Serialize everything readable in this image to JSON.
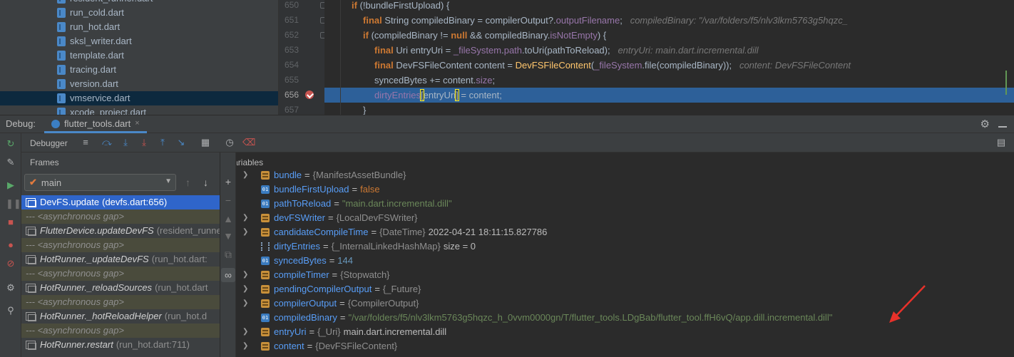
{
  "project_files": [
    {
      "name": "resident_runner.dart",
      "selected": false
    },
    {
      "name": "run_cold.dart",
      "selected": false
    },
    {
      "name": "run_hot.dart",
      "selected": false
    },
    {
      "name": "sksl_writer.dart",
      "selected": false
    },
    {
      "name": "template.dart",
      "selected": false
    },
    {
      "name": "tracing.dart",
      "selected": false
    },
    {
      "name": "version.dart",
      "selected": false
    },
    {
      "name": "vmservice.dart",
      "selected": true
    },
    {
      "name": "xcode_project.dart",
      "selected": false
    }
  ],
  "editor": {
    "line_numbers": [
      "650",
      "651",
      "652",
      "653",
      "654",
      "655",
      "656",
      "657"
    ],
    "current_line": "656",
    "code": {
      "l650": {
        "kw": "if",
        "text": " (!bundleFirstUpload) {"
      },
      "l651": {
        "kw": "final",
        "type": " String compiledBinary = compilerOutput?.",
        "field": "outputFilename",
        "tail": ";",
        "hint": "compiledBinary: \"/var/folders/f5/nlv3lkm5763g5hqzc_"
      },
      "l652": {
        "kw": "if",
        "a": " (compiledBinary != ",
        "kw2": "null",
        "b": " && compiledBinary.",
        "field": "isNotEmpty",
        "tail": ") {"
      },
      "l653": {
        "kw": "final",
        "a": " Uri entryUri = ",
        "field": "_fileSystem",
        "b": ".",
        "field2": "path",
        "c": ".toUri(pathToReload);",
        "hint": "entryUri: main.dart.incremental.dill"
      },
      "l654": {
        "kw": "final",
        "a": " DevFSFileContent content = ",
        "fn": "DevFSFileContent",
        "b": "(",
        "field": "_fileSystem",
        "c": ".file(compiledBinary));",
        "hint": "content: DevFSFileContent"
      },
      "l655": {
        "a": "syncedBytes += content.",
        "field": "size",
        "tail": ";"
      },
      "l656": {
        "field": "dirtyEntries",
        "b1": "[",
        "a": "entryUri",
        "b2": "]",
        "tail": " = content;"
      },
      "l657": {
        "text": "}"
      }
    }
  },
  "debug_bar": {
    "label": "Debug:",
    "tab": "flutter_tools.dart",
    "close": "×"
  },
  "toolbar": {
    "debugger_label": "Debugger"
  },
  "frames": {
    "header": "Frames",
    "thread": "main",
    "items": [
      {
        "name": "DevFS.update",
        "loc": "(devfs.dart:656)",
        "kind": "selected"
      },
      {
        "name": "--- <asynchronous gap>",
        "loc": "",
        "kind": "gap"
      },
      {
        "name": "FlutterDevice.updateDevFS",
        "loc": "(resident_runner.dart",
        "kind": "frame"
      },
      {
        "name": "--- <asynchronous gap>",
        "loc": "",
        "kind": "gap"
      },
      {
        "name": "HotRunner._updateDevFS",
        "loc": "(run_hot.dart:",
        "kind": "frame"
      },
      {
        "name": "--- <asynchronous gap>",
        "loc": "",
        "kind": "gap"
      },
      {
        "name": "HotRunner._reloadSources",
        "loc": "(run_hot.dart",
        "kind": "frame"
      },
      {
        "name": "--- <asynchronous gap>",
        "loc": "",
        "kind": "gap"
      },
      {
        "name": "HotRunner._hotReloadHelper",
        "loc": "(run_hot.d",
        "kind": "frame"
      },
      {
        "name": "--- <asynchronous gap>",
        "loc": "",
        "kind": "gap"
      },
      {
        "name": "HotRunner.restart",
        "loc": "(run_hot.dart:711)",
        "kind": "frame"
      }
    ]
  },
  "variables": {
    "header": "Variables",
    "items": [
      {
        "name": "bundle",
        "type": "{ManifestAssetBundle}",
        "value": "",
        "vkind": "plain",
        "icon": "obj",
        "expand": true
      },
      {
        "name": "bundleFirstUpload",
        "type": "",
        "value": "false",
        "vkind": "bool",
        "icon": "prim",
        "expand": false
      },
      {
        "name": "pathToReload",
        "type": "",
        "value": "\"main.dart.incremental.dill\"",
        "vkind": "str",
        "icon": "prim",
        "expand": false
      },
      {
        "name": "devFSWriter",
        "type": "{LocalDevFSWriter}",
        "value": "",
        "vkind": "plain",
        "icon": "obj",
        "expand": true
      },
      {
        "name": "candidateCompileTime",
        "type": "{DateTime}",
        "value": "2022-04-21 18:11:15.827786",
        "vkind": "plain",
        "icon": "obj",
        "expand": true
      },
      {
        "name": "dirtyEntries",
        "type": "{_InternalLinkedHashMap}",
        "value": "size = 0",
        "vkind": "plain",
        "icon": "map",
        "expand": false
      },
      {
        "name": "syncedBytes",
        "type": "",
        "value": "144",
        "vkind": "num",
        "icon": "prim",
        "expand": false
      },
      {
        "name": "compileTimer",
        "type": "{Stopwatch}",
        "value": "",
        "vkind": "plain",
        "icon": "obj",
        "expand": true
      },
      {
        "name": "pendingCompilerOutput",
        "type": "{_Future}",
        "value": "",
        "vkind": "plain",
        "icon": "obj",
        "expand": true
      },
      {
        "name": "compilerOutput",
        "type": "{CompilerOutput}",
        "value": "",
        "vkind": "plain",
        "icon": "obj",
        "expand": true
      },
      {
        "name": "compiledBinary",
        "type": "",
        "value": "\"/var/folders/f5/nlv3lkm5763g5hqzc_h_0vvm0000gn/T/flutter_tools.LDgBab/flutter_tool.ffH6vQ/app.dill.incremental.dill\"",
        "vkind": "str",
        "icon": "prim",
        "expand": false
      },
      {
        "name": "entryUri",
        "type": "{_Uri}",
        "value": "main.dart.incremental.dill",
        "vkind": "plain",
        "icon": "obj",
        "expand": true
      },
      {
        "name": "content",
        "type": "{DevFSFileContent}",
        "value": "",
        "vkind": "plain",
        "icon": "obj",
        "expand": true
      }
    ]
  },
  "colors": {
    "selection": "#2f65ca",
    "current_line": "#2d6099",
    "annotation_arrow": "#e8312a",
    "keyword": "#cc7832",
    "string": "#6a8759"
  },
  "icons": {
    "left_toolbar": [
      "rerun-icon",
      "wrench-icon",
      "resume-icon",
      "pause-icon",
      "stop-icon",
      "view-breakpoints-icon",
      "mute-breakpoints-icon",
      "settings-icon",
      "pin-icon"
    ],
    "debugger_toolbar": [
      "show-execution-point-icon",
      "step-over-icon",
      "step-into-icon",
      "force-step-into-icon",
      "step-out-icon",
      "run-to-cursor-icon",
      "evaluate-expression-icon",
      "trace-icon",
      "reset-frame-icon"
    ]
  }
}
